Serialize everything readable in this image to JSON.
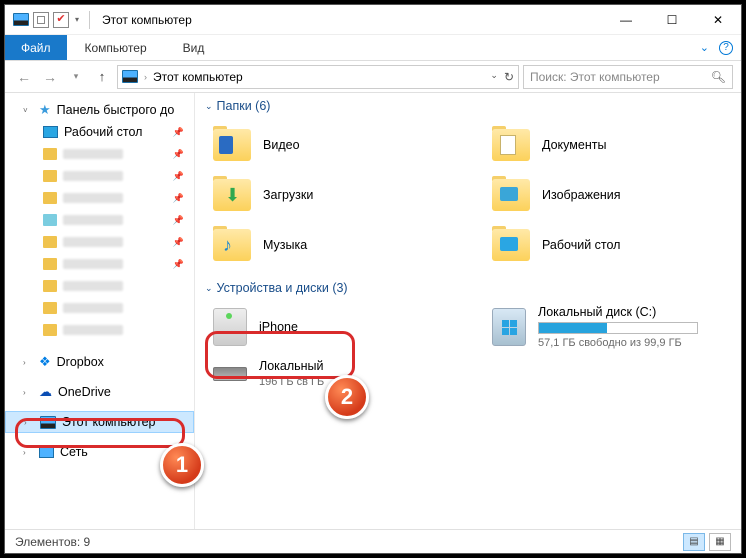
{
  "titlebar": {
    "title": "Этот компьютер"
  },
  "menubar": {
    "file": "Файл",
    "computer": "Компьютер",
    "view": "Вид"
  },
  "address": {
    "location": "Этот компьютер",
    "search_placeholder": "Поиск: Этот компьютер"
  },
  "sidebar": {
    "quick_access": "Панель быстрого до",
    "desktop": "Рабочий стол",
    "dropbox": "Dropbox",
    "onedrive": "OneDrive",
    "this_pc": "Этот компьютер",
    "network": "Сеть"
  },
  "sections": {
    "folders_header": "Папки (6)",
    "devices_header": "Устройства и диски (3)"
  },
  "folders": {
    "video": "Видео",
    "documents": "Документы",
    "downloads": "Загрузки",
    "pictures": "Изображения",
    "music": "Музыка",
    "desktop": "Рабочий стол"
  },
  "devices": {
    "iphone": {
      "name": "iPhone"
    },
    "disk_c": {
      "name": "Локальный диск (C:)",
      "sub": "57,1 ГБ свободно из 99,9 ГБ",
      "fill_pct": 43
    },
    "disk_d": {
      "name": "Локальный",
      "sub": "196 ГБ св                        ГБ"
    }
  },
  "statusbar": {
    "items": "Элементов: 9"
  },
  "markers": {
    "one": "1",
    "two": "2"
  }
}
